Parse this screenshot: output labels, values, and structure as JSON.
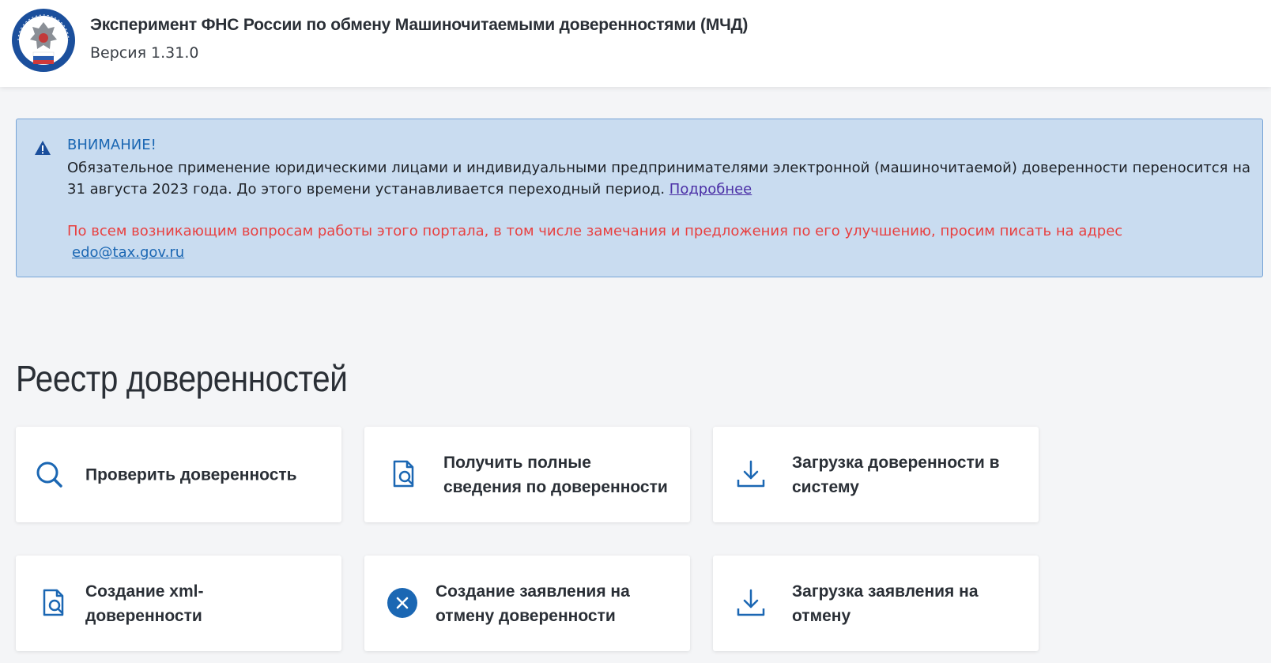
{
  "header": {
    "title": "Эксперимент ФНС России по обмену Машиночитаемыми доверенностями (МЧД)",
    "version": "Версия 1.31.0",
    "logo_icon": "fns-emblem-logo"
  },
  "alert": {
    "icon": "warning-triangle-icon",
    "title": "ВНИМАНИЕ!",
    "text": "Обязательное применение юридическими лицами и индивидуальными предпринимателями электронной (машиночитаемой) доверенности переносится на 31 августа 2023 года. До этого времени устанавливается переходный период.",
    "link_label": "Подробнее",
    "contact_text": "По всем возникающим вопросам работы этого портала, в том числе замечания и предложения по его улучшению, просим писать на адрес",
    "email": "edo@tax.gov.ru",
    "colors": {
      "background": "#c9dcf0",
      "border": "#77a4d6",
      "title": "#1b67b3",
      "contact": "#e84040"
    }
  },
  "registry": {
    "title": "Реестр доверенностей",
    "cards": [
      {
        "label": "Проверить доверенность",
        "icon": "search-icon"
      },
      {
        "label": "Получить полные сведения по доверенности",
        "icon": "document-search-icon"
      },
      {
        "label": "Загрузка доверенности в систему",
        "icon": "download-icon"
      },
      {
        "label": "Создание xml-доверенности",
        "icon": "document-search-icon"
      },
      {
        "label": "Создание заявления на отмену доверенности",
        "icon": "cancel-circle-icon"
      },
      {
        "label": "Загрузка заявления на отмену",
        "icon": "download-icon"
      }
    ]
  },
  "colors": {
    "accent": "#1b67b3",
    "page_background": "#f4f5f7"
  }
}
